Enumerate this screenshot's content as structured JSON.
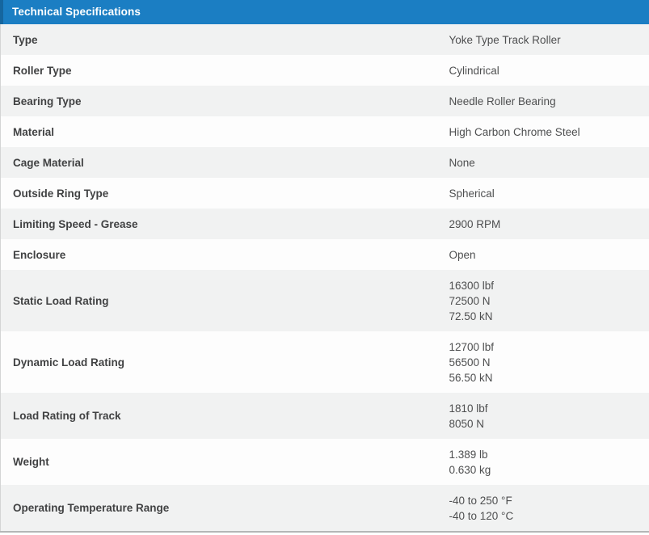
{
  "header": {
    "title": "Technical Specifications"
  },
  "colors": {
    "header_bg": "#1b7ec3",
    "header_accent": "#15669f",
    "row_gray": "#f1f2f2",
    "row_white": "#fdfdfd",
    "label_text": "#414243",
    "value_text": "#4e4f50",
    "bottom_border": "#b4b6b6"
  },
  "table": {
    "rows": [
      {
        "label": "Type",
        "values": [
          "Yoke Type Track Roller"
        ]
      },
      {
        "label": "Roller Type",
        "values": [
          "Cylindrical"
        ]
      },
      {
        "label": "Bearing Type",
        "values": [
          "Needle Roller Bearing"
        ]
      },
      {
        "label": "Material",
        "values": [
          "High Carbon Chrome Steel"
        ]
      },
      {
        "label": "Cage Material",
        "values": [
          "None"
        ]
      },
      {
        "label": "Outside Ring Type",
        "values": [
          "Spherical"
        ]
      },
      {
        "label": "Limiting Speed - Grease",
        "values": [
          "2900 RPM"
        ]
      },
      {
        "label": "Enclosure",
        "values": [
          "Open"
        ]
      },
      {
        "label": "Static Load Rating",
        "values": [
          "16300 lbf",
          "72500 N",
          "72.50 kN"
        ]
      },
      {
        "label": "Dynamic Load Rating",
        "values": [
          "12700 lbf",
          "56500 N",
          "56.50 kN"
        ]
      },
      {
        "label": "Load Rating of Track",
        "values": [
          "1810 lbf",
          "8050 N"
        ]
      },
      {
        "label": "Weight",
        "values": [
          "1.389 lb",
          "0.630 kg"
        ]
      },
      {
        "label": "Operating Temperature Range",
        "values": [
          "-40 to 250 °F",
          "-40 to 120 °C"
        ]
      }
    ]
  }
}
